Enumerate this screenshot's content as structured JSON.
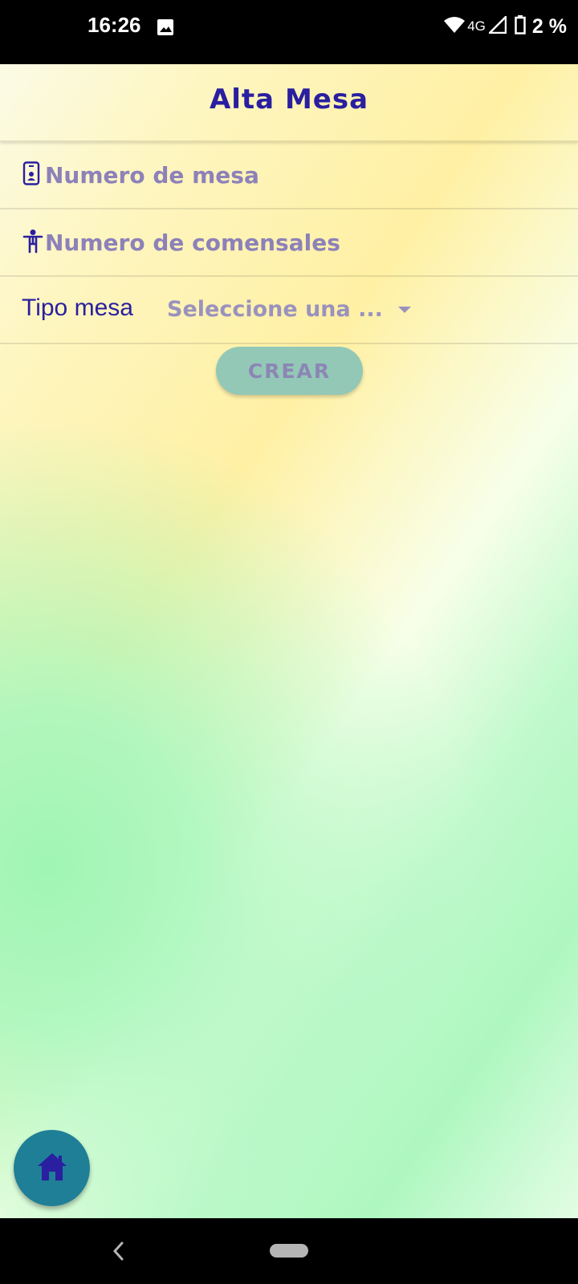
{
  "status_bar": {
    "time": "16:26",
    "network": "4G",
    "battery": "2 %",
    "icons": [
      "image-icon",
      "wifi-icon",
      "signal-icon",
      "battery-icon"
    ]
  },
  "header": {
    "title": "Alta Mesa"
  },
  "form": {
    "table_number": {
      "placeholder": "Numero de mesa",
      "value": "",
      "icon": "phone-badge-icon"
    },
    "guests": {
      "placeholder": "Numero de comensales",
      "value": "",
      "icon": "accessibility-person-icon"
    },
    "table_type": {
      "label": "Tipo mesa",
      "selected": "Seleccione una ..."
    },
    "submit_label": "CREAR"
  },
  "fab": {
    "icon": "home-icon"
  },
  "colors": {
    "primary_text": "#2a1fa0",
    "placeholder": "#8d81b9",
    "button_bg": "#93c8b7",
    "fab_bg": "#1f7f97"
  }
}
